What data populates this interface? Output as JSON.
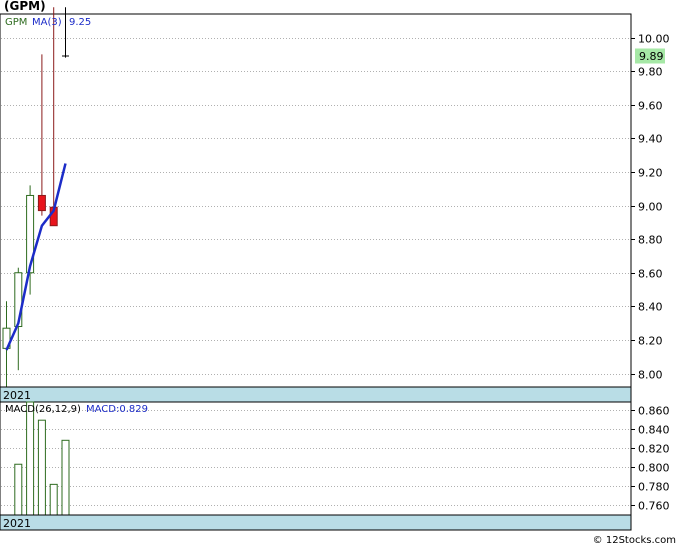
{
  "title": "(GPM)",
  "footer": "© 12Stocks.com",
  "price_panel": {
    "legend_symbol": "GPM",
    "legend_ma_label": "MA(3)",
    "legend_ma_value": "9.25",
    "last_price_label": "9.89",
    "year_label": "2021"
  },
  "macd_panel": {
    "legend_label": "MACD(26,12,9)",
    "legend_value": "MACD:0.829",
    "year_label": "2021"
  },
  "colors": {
    "up": "#2e6b1f",
    "down": "#e8141c",
    "down_wick": "#8b1a1a",
    "ma": "#1c2cc8",
    "macd_bar": "#2e6b1f",
    "band": "#b9dde6",
    "price_tag": "#a6e8a6",
    "grid": "#b0b0b0",
    "legend_symbol": "#2e6b1f",
    "legend_ma": "#1c2cc8"
  },
  "chart_data": [
    {
      "type": "candlestick",
      "y_axis_side": "right",
      "ylim": [
        7.92,
        10.14
      ],
      "y_ticks": [
        8.0,
        8.2,
        8.4,
        8.6,
        8.8,
        9.0,
        9.2,
        9.4,
        9.6,
        9.8,
        10.0
      ],
      "y_tick_labels": [
        "8.00",
        "8.20",
        "8.40",
        "8.60",
        "8.80",
        "9.00",
        "9.20",
        "9.40",
        "9.60",
        "9.80",
        "10.00"
      ],
      "grid": true,
      "candles": [
        {
          "open": 8.15,
          "high": 8.43,
          "low": 7.92,
          "close": 8.27
        },
        {
          "open": 8.28,
          "high": 8.63,
          "low": 8.02,
          "close": 8.6
        },
        {
          "open": 8.6,
          "high": 9.12,
          "low": 8.47,
          "close": 9.06
        },
        {
          "open": 9.06,
          "high": 9.9,
          "low": 8.94,
          "close": 8.97
        },
        {
          "open": 8.99,
          "high": 10.18,
          "low": 8.88,
          "close": 8.88
        },
        {
          "open": 9.89,
          "high": 10.18,
          "low": 9.88,
          "close": 9.89
        }
      ],
      "ma_period": 3,
      "ma_points": [
        {
          "i": 0,
          "v": 8.14
        },
        {
          "i": 1,
          "v": 8.3
        },
        {
          "i": 2,
          "v": 8.64
        },
        {
          "i": 3,
          "v": 8.88
        },
        {
          "i": 4,
          "v": 8.97
        },
        {
          "i": 5,
          "v": 9.25
        }
      ],
      "last_price": 9.89
    },
    {
      "type": "bar",
      "series": [
        {
          "name": "MACD",
          "values": [
            null,
            0.803,
            0.868,
            0.849,
            0.782,
            0.828
          ]
        }
      ],
      "ylim": [
        0.75,
        0.868
      ],
      "y_ticks": [
        0.76,
        0.78,
        0.8,
        0.82,
        0.84,
        0.86
      ],
      "y_tick_labels": [
        "0.760",
        "0.780",
        "0.800",
        "0.820",
        "0.840",
        "0.860"
      ],
      "grid": true
    }
  ]
}
